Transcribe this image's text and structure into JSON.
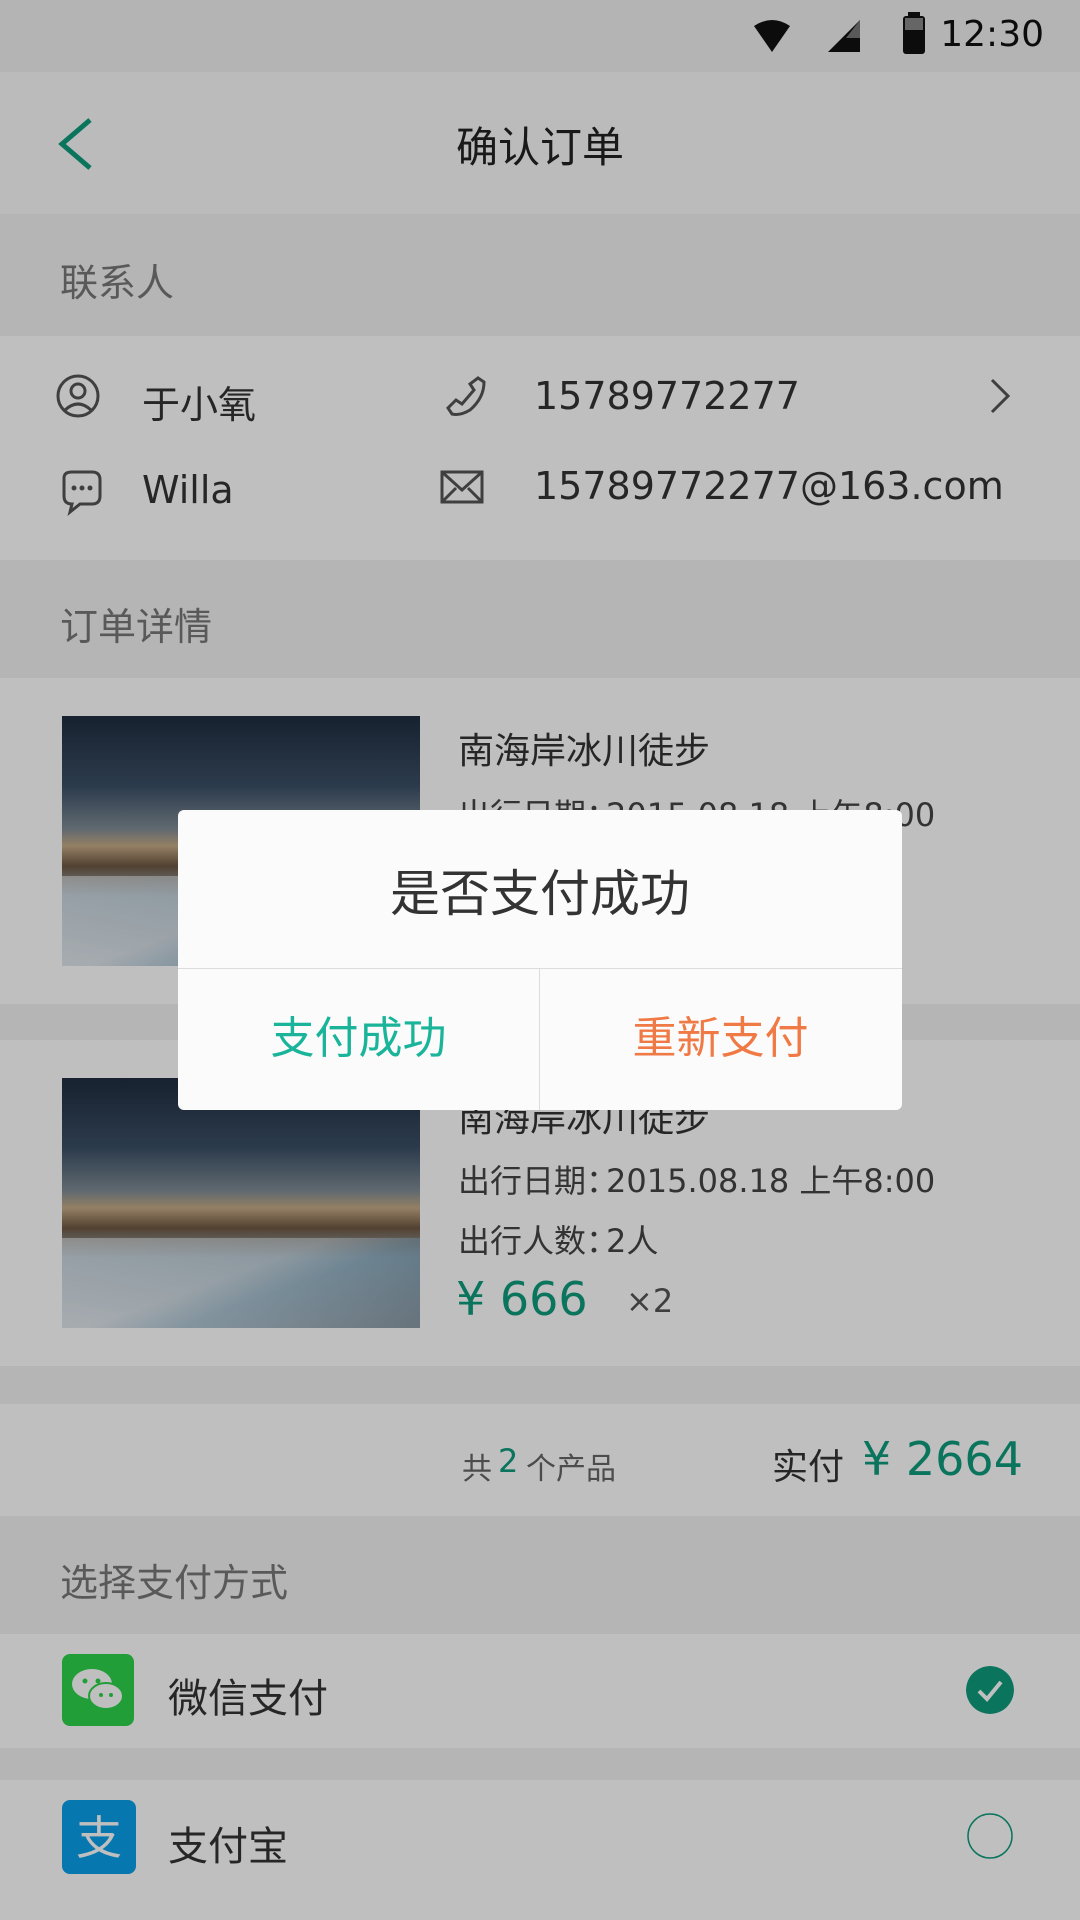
{
  "status_bar": {
    "time": "12:30"
  },
  "header": {
    "title": "确认订单"
  },
  "contact": {
    "section_title": "联系人",
    "name": "于小氧",
    "phone": "15789772277",
    "wechat": "Willa",
    "email": "15789772277@163.com"
  },
  "order": {
    "section_title": "订单详情",
    "items": [
      {
        "title": "南海岸冰川徒步",
        "date_label": "出行日期：",
        "date_value": "2015.08.18  上午8:00"
      },
      {
        "title": "南海岸冰川徒步",
        "date_label": "出行日期：",
        "date_value": "2015.08.18  上午8:00",
        "people_label": "出行人数：",
        "people_value": "2人",
        "price": "¥ 666",
        "qty": "×2"
      }
    ],
    "summary": {
      "count_prefix": "共",
      "count": "2",
      "count_suffix": "个产品",
      "paid_label": "实付",
      "paid_amount": "¥ 2664"
    }
  },
  "payment": {
    "section_title": "选择支付方式",
    "methods": [
      {
        "name": "微信支付",
        "selected": true
      },
      {
        "name": "支付宝",
        "selected": false
      }
    ]
  },
  "dialog": {
    "title": "是否支付成功",
    "confirm_label": "支付成功",
    "retry_label": "重新支付"
  },
  "colors": {
    "accent": "#0f9b7d",
    "retry": "#f07a45",
    "wechat_green": "#2ed34d",
    "alipay_blue": "#0aa0ea"
  }
}
